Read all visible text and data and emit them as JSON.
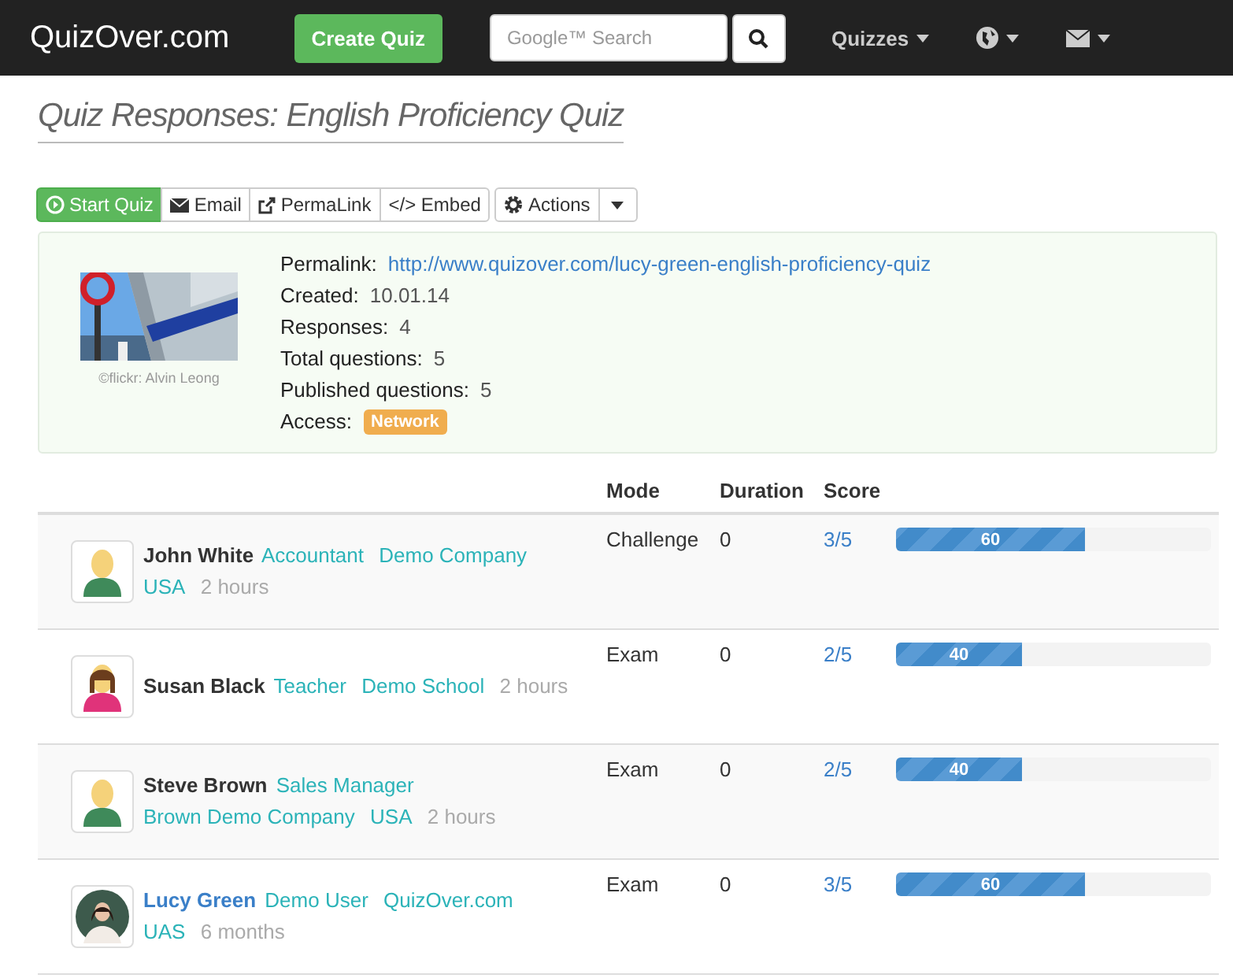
{
  "navbar": {
    "brand": "QuizOver.com",
    "create_button": "Create Quiz",
    "search": {
      "placeholder": "Google™ Search"
    },
    "menus": [
      {
        "kind": "text",
        "label": "Quizzes"
      },
      {
        "kind": "globe"
      },
      {
        "kind": "mail"
      }
    ]
  },
  "page_title": "Quiz Responses: English Proficiency Quiz",
  "toolbar": {
    "buttons": [
      {
        "kind": "play",
        "label": "Start Quiz",
        "selected": true
      },
      {
        "kind": "mail",
        "label": "Email",
        "selected": false
      },
      {
        "kind": "share",
        "label": "PermaLink",
        "selected": false
      },
      {
        "kind": "code",
        "label": "</> Embed",
        "selected": false
      }
    ],
    "actions": "Actions"
  },
  "info": {
    "caption": "©flickr: Alvin Leong",
    "fields": [
      {
        "label": "Permalink:",
        "value": "http://www.quizover.com/lucy-green-english-proficiency-quiz",
        "kind": "link"
      },
      {
        "label": "Created:",
        "value": "10.01.14",
        "kind": "text"
      },
      {
        "label": "Responses:",
        "value": "4",
        "kind": "text"
      },
      {
        "label": "Total questions:",
        "value": "5",
        "kind": "text"
      },
      {
        "label": "Published questions:",
        "value": "5",
        "kind": "text"
      },
      {
        "label": "Access:",
        "value": "Network",
        "kind": "badge"
      }
    ]
  },
  "table": {
    "columns": [
      "Mode",
      "Duration",
      "Score"
    ],
    "rows": [
      {
        "avatar": {
          "kind": "male"
        },
        "name": "John White",
        "name_link": false,
        "details": [
          {
            "kind": "tag",
            "text": "Accountant"
          },
          {
            "kind": "tag",
            "text": "Demo Company"
          },
          {
            "kind": "tag",
            "text": "USA"
          },
          {
            "kind": "time",
            "text": "2 hours"
          }
        ],
        "mode": "Challenge",
        "duration": "0",
        "score": "3/5",
        "level": 0.6,
        "bar_label": "60"
      },
      {
        "avatar": {
          "kind": "female"
        },
        "name": "Susan Black",
        "name_link": false,
        "details": [
          {
            "kind": "tag",
            "text": "Teacher"
          },
          {
            "kind": "tag",
            "text": "Demo School"
          },
          {
            "kind": "time",
            "text": "2 hours"
          }
        ],
        "mode": "Exam",
        "duration": "0",
        "score": "2/5",
        "level": 0.4,
        "bar_label": "40"
      },
      {
        "avatar": {
          "kind": "male"
        },
        "name": "Steve Brown",
        "name_link": false,
        "details": [
          {
            "kind": "tag",
            "text": "Sales Manager"
          },
          {
            "kind": "tag",
            "text": "Brown Demo Company"
          },
          {
            "kind": "tag",
            "text": "USA"
          },
          {
            "kind": "time",
            "text": "2 hours"
          }
        ],
        "mode": "Exam",
        "duration": "0",
        "score": "2/5",
        "level": 0.4,
        "bar_label": "40"
      },
      {
        "name": "Lucy Green",
        "name_link": true,
        "details": [
          {
            "kind": "tag",
            "text": "Demo User"
          },
          {
            "kind": "tag",
            "text": "QuizOver.com"
          },
          {
            "kind": "tag",
            "text": "UAS"
          },
          {
            "kind": "time",
            "text": "6 months"
          }
        ],
        "mode": "Exam",
        "duration": "0",
        "score": "3/5",
        "level": 0.6,
        "bar_label": "60"
      }
    ]
  }
}
